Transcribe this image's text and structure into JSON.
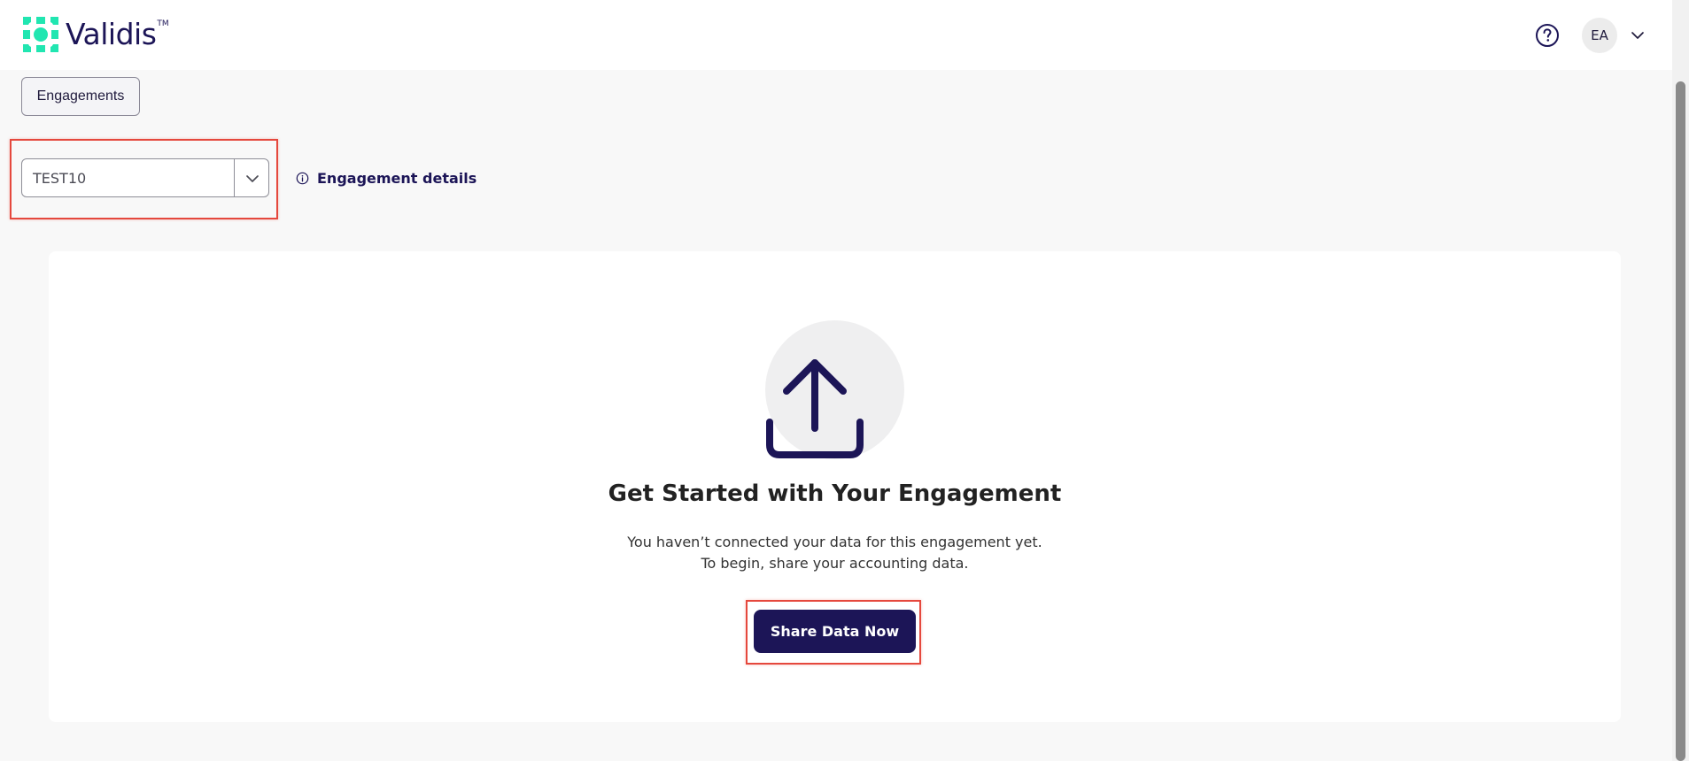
{
  "app": {
    "logo_text": "Validis",
    "logo_mark": "TM",
    "brand_color": "#1c1557",
    "accent_color": "#21e6b1"
  },
  "header": {
    "help_icon": "question-circle-icon",
    "avatar_initials": "EA",
    "avatar_chevron_icon": "chevron-down-icon"
  },
  "nav": {
    "engagements_label": "Engagements"
  },
  "engagement_selector": {
    "selected_value": "TEST10",
    "chevron_icon": "chevron-down-icon"
  },
  "engagement_details": {
    "label": "Engagement details",
    "icon": "info-circle-icon"
  },
  "empty_state": {
    "icon": "upload-icon",
    "title": "Get Started with Your Engagement",
    "line_1": "You haven’t connected your data for this engagement yet.",
    "line_2": "To begin, share your accounting data.",
    "button_label": "Share Data Now"
  },
  "highlight_color": "#e5483d"
}
